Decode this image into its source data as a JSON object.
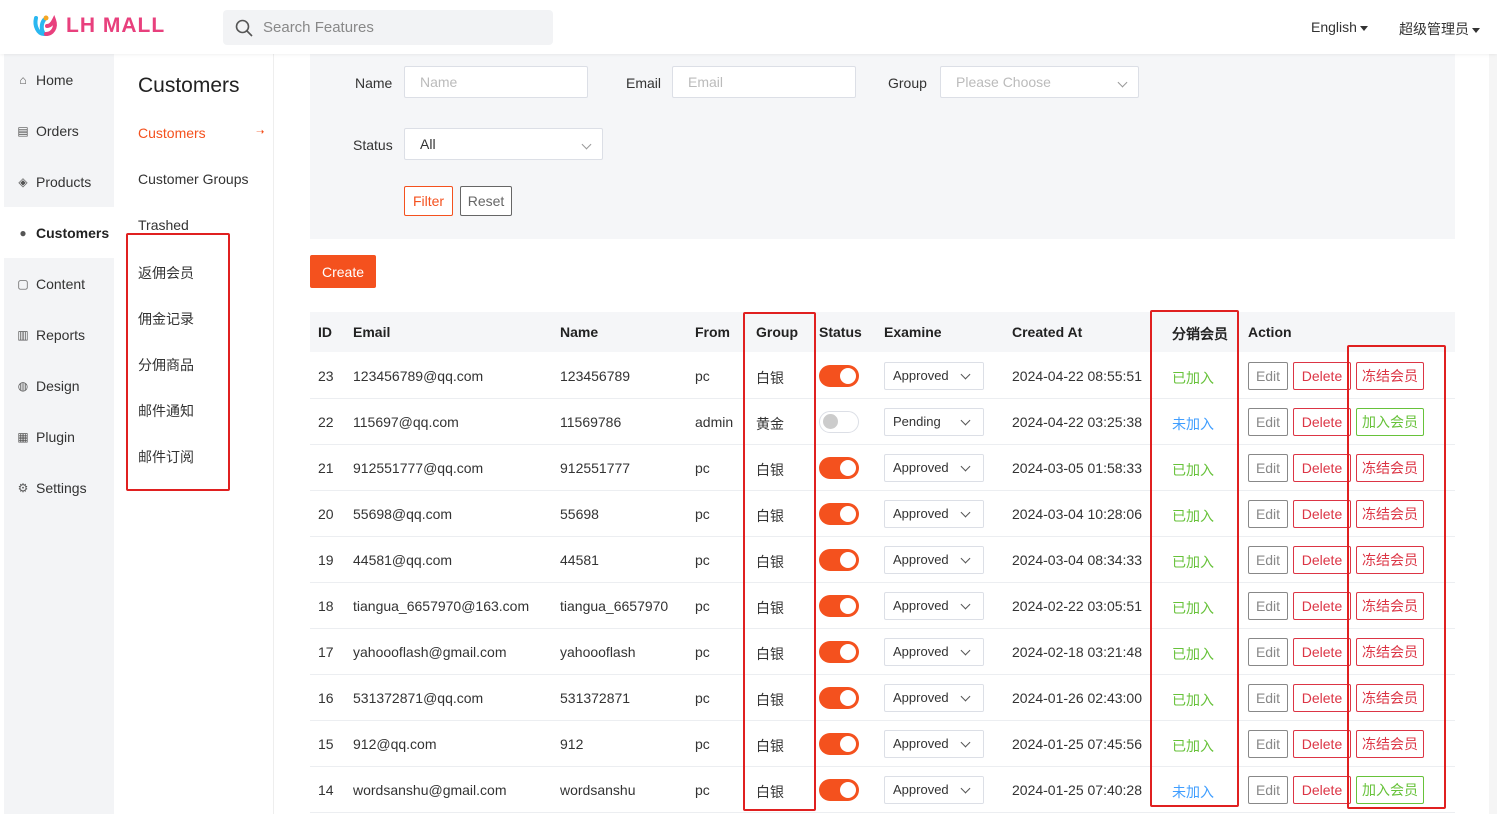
{
  "app": {
    "logo_text": "LH MALL",
    "search_placeholder": "Search Features",
    "language": "English",
    "user": "超级管理员"
  },
  "sidebar": {
    "items": [
      {
        "label": "Home",
        "icon": "home-icon",
        "glyph": "⌂"
      },
      {
        "label": "Orders",
        "icon": "clipboard-icon",
        "glyph": "▤"
      },
      {
        "label": "Products",
        "icon": "box-icon",
        "glyph": "◈"
      },
      {
        "label": "Customers",
        "icon": "user-circle-icon",
        "glyph": "●",
        "active": true
      },
      {
        "label": "Content",
        "icon": "document-icon",
        "glyph": "▢"
      },
      {
        "label": "Reports",
        "icon": "bar-chart-icon",
        "glyph": "▥"
      },
      {
        "label": "Design",
        "icon": "palette-icon",
        "glyph": "◍"
      },
      {
        "label": "Plugin",
        "icon": "store-icon",
        "glyph": "▦"
      },
      {
        "label": "Settings",
        "icon": "gear-icon",
        "glyph": "⚙"
      }
    ]
  },
  "subnav": {
    "title": "Customers",
    "items": [
      "Customers",
      "Customer Groups",
      "Trashed",
      "返佣会员",
      "佣金记录",
      "分佣商品",
      "邮件通知",
      "邮件订阅"
    ]
  },
  "filter": {
    "name_label": "Name",
    "name_placeholder": "Name",
    "email_label": "Email",
    "email_placeholder": "Email",
    "group_label": "Group",
    "group_placeholder": "Please Choose",
    "status_label": "Status",
    "status_value": "All",
    "filter_button": "Filter",
    "reset_button": "Reset"
  },
  "create_button": "Create",
  "table": {
    "headers": [
      "ID",
      "Email",
      "Name",
      "From",
      "Group",
      "Status",
      "Examine",
      "Created At",
      "分销会员",
      "Action"
    ],
    "edit_label": "Edit",
    "delete_label": "Delete",
    "rows": [
      {
        "id": "23",
        "email": "123456789@qq.com",
        "name": "123456789",
        "from": "pc",
        "group": "白银",
        "status": true,
        "examine": "Approved",
        "created": "2024-04-22 08:55:51",
        "member": "已加入",
        "member_state": "joined",
        "action": "冻结会员"
      },
      {
        "id": "22",
        "email": "115697@qq.com",
        "name": "11569786",
        "from": "admin",
        "group": "黄金",
        "status": false,
        "examine": "Pending",
        "created": "2024-04-22 03:25:38",
        "member": "未加入",
        "member_state": "notjoined",
        "action": "加入会员"
      },
      {
        "id": "21",
        "email": "912551777@qq.com",
        "name": "912551777",
        "from": "pc",
        "group": "白银",
        "status": true,
        "examine": "Approved",
        "created": "2024-03-05 01:58:33",
        "member": "已加入",
        "member_state": "joined",
        "action": "冻结会员"
      },
      {
        "id": "20",
        "email": "55698@qq.com",
        "name": "55698",
        "from": "pc",
        "group": "白银",
        "status": true,
        "examine": "Approved",
        "created": "2024-03-04 10:28:06",
        "member": "已加入",
        "member_state": "joined",
        "action": "冻结会员"
      },
      {
        "id": "19",
        "email": "44581@qq.com",
        "name": "44581",
        "from": "pc",
        "group": "白银",
        "status": true,
        "examine": "Approved",
        "created": "2024-03-04 08:34:33",
        "member": "已加入",
        "member_state": "joined",
        "action": "冻结会员"
      },
      {
        "id": "18",
        "email": "tiangua_6657970@163.com",
        "name": "tiangua_6657970",
        "from": "pc",
        "group": "白银",
        "status": true,
        "examine": "Approved",
        "created": "2024-02-22 03:05:51",
        "member": "已加入",
        "member_state": "joined",
        "action": "冻结会员"
      },
      {
        "id": "17",
        "email": "yahoooflash@gmail.com",
        "name": "yahoooflash",
        "from": "pc",
        "group": "白银",
        "status": true,
        "examine": "Approved",
        "created": "2024-02-18 03:21:48",
        "member": "已加入",
        "member_state": "joined",
        "action": "冻结会员"
      },
      {
        "id": "16",
        "email": "531372871@qq.com",
        "name": "531372871",
        "from": "pc",
        "group": "白银",
        "status": true,
        "examine": "Approved",
        "created": "2024-01-26 02:43:00",
        "member": "已加入",
        "member_state": "joined",
        "action": "冻结会员"
      },
      {
        "id": "15",
        "email": "912@qq.com",
        "name": "912",
        "from": "pc",
        "group": "白银",
        "status": true,
        "examine": "Approved",
        "created": "2024-01-25 07:45:56",
        "member": "已加入",
        "member_state": "joined",
        "action": "冻结会员"
      },
      {
        "id": "14",
        "email": "wordsanshu@gmail.com",
        "name": "wordsanshu",
        "from": "pc",
        "group": "白银",
        "status": true,
        "examine": "Approved",
        "created": "2024-01-25 07:40:28",
        "member": "未加入",
        "member_state": "notjoined",
        "action": "加入会员"
      }
    ]
  },
  "colors": {
    "accent": "#f4511e",
    "joined": "#67c23a",
    "notjoined": "#409eff",
    "danger": "#dc3545",
    "highlight": "#e02020"
  }
}
